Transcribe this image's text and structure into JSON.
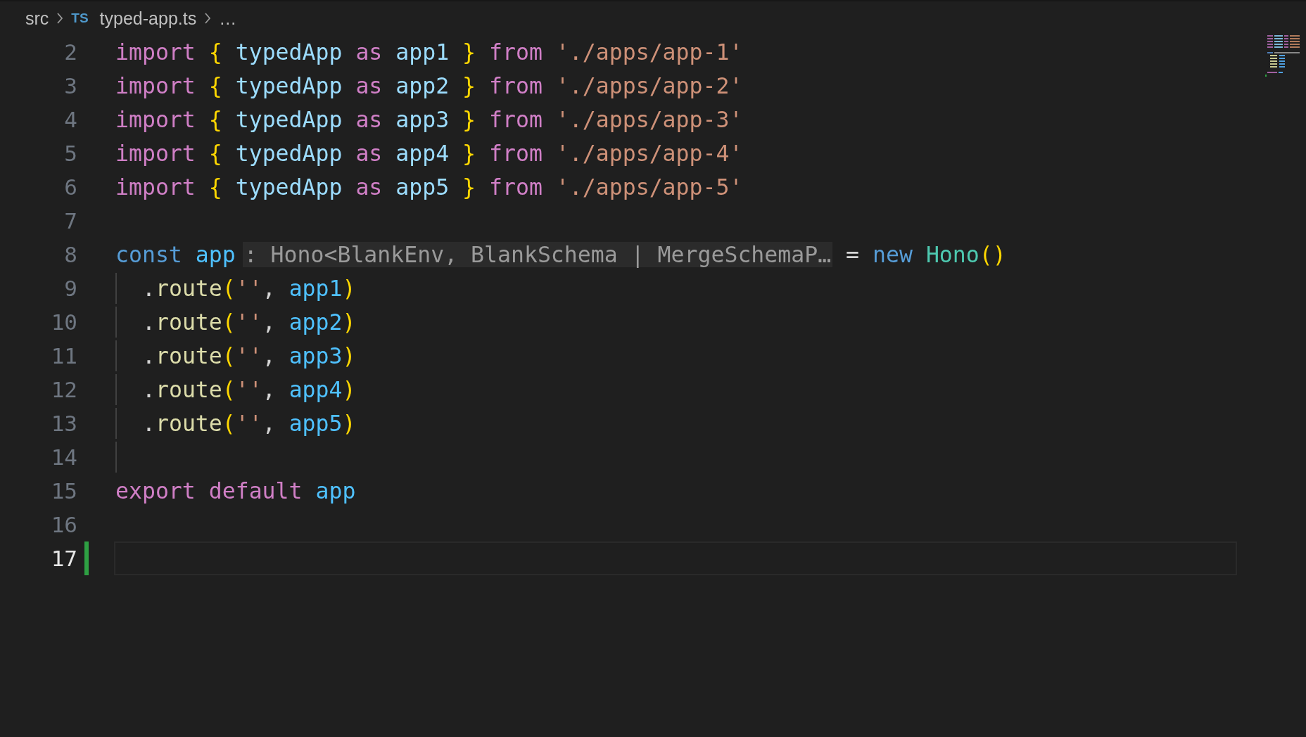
{
  "breadcrumbs": [
    {
      "kind": "folder",
      "text": "src"
    },
    {
      "kind": "file",
      "badge": "TS",
      "text": "typed-app.ts"
    },
    {
      "kind": "more",
      "text": "…"
    }
  ],
  "lines": [
    {
      "number": "2",
      "selected": false,
      "added": false,
      "indented": false,
      "tokens": [
        {
          "kind": "kw",
          "text": "import"
        },
        {
          "kind": "brace",
          "text": " {"
        },
        {
          "kind": "id",
          "text": " typedApp"
        },
        {
          "kind": "kw",
          "text": " as"
        },
        {
          "kind": "id",
          "text": " app1"
        },
        {
          "kind": "brace",
          "text": " }"
        },
        {
          "kind": "kw",
          "text": " from"
        },
        {
          "kind": "str",
          "text": " './apps/app-1'"
        }
      ]
    },
    {
      "number": "3",
      "selected": false,
      "added": false,
      "indented": false,
      "tokens": [
        {
          "kind": "kw",
          "text": "import"
        },
        {
          "kind": "brace",
          "text": " {"
        },
        {
          "kind": "id",
          "text": " typedApp"
        },
        {
          "kind": "kw",
          "text": " as"
        },
        {
          "kind": "id",
          "text": " app2"
        },
        {
          "kind": "brace",
          "text": " }"
        },
        {
          "kind": "kw",
          "text": " from"
        },
        {
          "kind": "str",
          "text": " './apps/app-2'"
        }
      ]
    },
    {
      "number": "4",
      "selected": false,
      "added": false,
      "indented": false,
      "tokens": [
        {
          "kind": "kw",
          "text": "import"
        },
        {
          "kind": "brace",
          "text": " {"
        },
        {
          "kind": "id",
          "text": " typedApp"
        },
        {
          "kind": "kw",
          "text": " as"
        },
        {
          "kind": "id",
          "text": " app3"
        },
        {
          "kind": "brace",
          "text": " }"
        },
        {
          "kind": "kw",
          "text": " from"
        },
        {
          "kind": "str",
          "text": " './apps/app-3'"
        }
      ]
    },
    {
      "number": "5",
      "selected": false,
      "added": false,
      "indented": false,
      "tokens": [
        {
          "kind": "kw",
          "text": "import"
        },
        {
          "kind": "brace",
          "text": " {"
        },
        {
          "kind": "id",
          "text": " typedApp"
        },
        {
          "kind": "kw",
          "text": " as"
        },
        {
          "kind": "id",
          "text": " app4"
        },
        {
          "kind": "brace",
          "text": " }"
        },
        {
          "kind": "kw",
          "text": " from"
        },
        {
          "kind": "str",
          "text": " './apps/app-4'"
        }
      ]
    },
    {
      "number": "6",
      "selected": false,
      "added": false,
      "indented": false,
      "tokens": [
        {
          "kind": "kw",
          "text": "import"
        },
        {
          "kind": "brace",
          "text": " {"
        },
        {
          "kind": "id",
          "text": " typedApp"
        },
        {
          "kind": "kw",
          "text": " as"
        },
        {
          "kind": "id",
          "text": " app5"
        },
        {
          "kind": "brace",
          "text": " }"
        },
        {
          "kind": "kw",
          "text": " from"
        },
        {
          "kind": "str",
          "text": " './apps/app-5'"
        }
      ]
    },
    {
      "number": "7",
      "selected": false,
      "added": false,
      "indented": false
    },
    {
      "number": "8",
      "selected": false,
      "added": false,
      "indented": false,
      "tokens": [
        {
          "kind": "storage",
          "text": "const"
        },
        {
          "kind": "var",
          "text": " app"
        },
        {
          "kind": "hint",
          "text": ": Hono<BlankEnv, BlankSchema | MergeSchemaP…"
        },
        {
          "kind": "punct",
          "text": " ="
        },
        {
          "kind": "storage",
          "text": " new"
        },
        {
          "kind": "cls",
          "text": " Hono"
        },
        {
          "kind": "paren",
          "text": "()"
        }
      ]
    },
    {
      "number": "9",
      "selected": false,
      "added": false,
      "indented": true,
      "tokens": [
        {
          "kind": "punct",
          "text": "."
        },
        {
          "kind": "fn",
          "text": "route"
        },
        {
          "kind": "paren",
          "text": "("
        },
        {
          "kind": "str",
          "text": "''"
        },
        {
          "kind": "punct",
          "text": ","
        },
        {
          "kind": "var",
          "text": " app1"
        },
        {
          "kind": "paren",
          "text": ")"
        }
      ]
    },
    {
      "number": "10",
      "selected": false,
      "added": false,
      "indented": true,
      "tokens": [
        {
          "kind": "punct",
          "text": "."
        },
        {
          "kind": "fn",
          "text": "route"
        },
        {
          "kind": "paren",
          "text": "("
        },
        {
          "kind": "str",
          "text": "''"
        },
        {
          "kind": "punct",
          "text": ","
        },
        {
          "kind": "var",
          "text": " app2"
        },
        {
          "kind": "paren",
          "text": ")"
        }
      ]
    },
    {
      "number": "11",
      "selected": false,
      "added": false,
      "indented": true,
      "tokens": [
        {
          "kind": "punct",
          "text": "."
        },
        {
          "kind": "fn",
          "text": "route"
        },
        {
          "kind": "paren",
          "text": "("
        },
        {
          "kind": "str",
          "text": "''"
        },
        {
          "kind": "punct",
          "text": ","
        },
        {
          "kind": "var",
          "text": " app3"
        },
        {
          "kind": "paren",
          "text": ")"
        }
      ]
    },
    {
      "number": "12",
      "selected": false,
      "added": false,
      "indented": true,
      "tokens": [
        {
          "kind": "punct",
          "text": "."
        },
        {
          "kind": "fn",
          "text": "route"
        },
        {
          "kind": "paren",
          "text": "("
        },
        {
          "kind": "str",
          "text": "''"
        },
        {
          "kind": "punct",
          "text": ","
        },
        {
          "kind": "var",
          "text": " app4"
        },
        {
          "kind": "paren",
          "text": ")"
        }
      ]
    },
    {
      "number": "13",
      "selected": false,
      "added": false,
      "indented": true,
      "tokens": [
        {
          "kind": "punct",
          "text": "."
        },
        {
          "kind": "fn",
          "text": "route"
        },
        {
          "kind": "paren",
          "text": "("
        },
        {
          "kind": "str",
          "text": "''"
        },
        {
          "kind": "punct",
          "text": ","
        },
        {
          "kind": "var",
          "text": " app5"
        },
        {
          "kind": "paren",
          "text": ")"
        }
      ]
    },
    {
      "number": "14",
      "selected": false,
      "added": false,
      "indented": true
    },
    {
      "number": "15",
      "selected": false,
      "added": false,
      "indented": false,
      "tokens": [
        {
          "kind": "kw",
          "text": "export"
        },
        {
          "kind": "kw",
          "text": " default"
        },
        {
          "kind": "var",
          "text": " app"
        }
      ]
    },
    {
      "number": "16",
      "selected": false,
      "added": false,
      "indented": false
    },
    {
      "number": "17",
      "selected": true,
      "added": true,
      "indented": false
    }
  ]
}
